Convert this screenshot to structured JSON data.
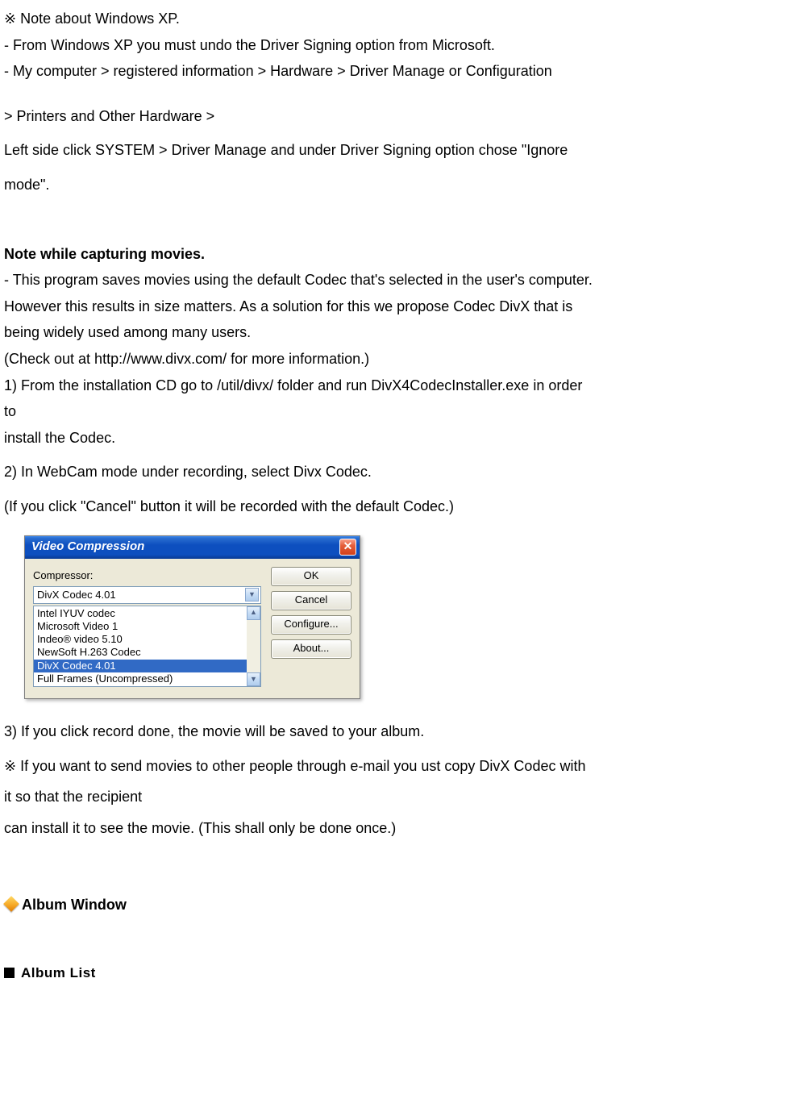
{
  "intro": {
    "note_symbol": "※",
    "note_text": "Note about Windows XP.",
    "bullet1_dash": "-",
    "bullet1_text": "From Windows XP you must undo the Driver Signing option from Microsoft.",
    "bullet2_dash": "-",
    "bullet2_text": "My computer > registered information > Hardware > Driver Manage or Configuration",
    "path_line": "> Printers and Other Hardware >",
    "instruction_line1": "Left side click SYSTEM > Driver Manage and under Driver Signing option chose \"Ignore",
    "instruction_line2": "mode\"."
  },
  "movies": {
    "heading": "Note while capturing movies.",
    "bullet_dash": "-",
    "bullet_text": "This program saves movies using the default Codec that's selected in the user's computer.",
    "para_line1": "However this results in size matters. As a solution for this we propose Codec DivX that is",
    "para_line2": "being widely used among many users.",
    "para_line3": "(Check out at http://www.divx.com/ for more information.)",
    "step1_line1": "1) From the installation CD go to /util/divx/ folder and run DivX4CodecInstaller.exe in order",
    "step1_line2": "to",
    "step1_line3": " install the Codec.",
    "step2": "2) In WebCam mode under recording, select Divx Codec.",
    "cancel_note": "(If you click \"Cancel\" button it will be recorded with the default Codec.)"
  },
  "dialog": {
    "title": "Video Compression",
    "close_x": "✕",
    "compressor_label": "Compressor:",
    "combo_value": "DivX Codec 4.01",
    "list": {
      "0": "Intel IYUV codec",
      "1": "Microsoft Video 1",
      "2": "Indeo® video 5.10",
      "3": "NewSoft H.263 Codec",
      "4": "DivX Codec 4.01",
      "5": "Full Frames (Uncompressed)"
    },
    "buttons": {
      "ok": "OK",
      "cancel": "Cancel",
      "configure": "Configure...",
      "about": "About..."
    }
  },
  "after_dialog": {
    "step3": "3) If you click record done, the movie will be saved to your album.",
    "note_symbol": "※",
    "note_line1": "If you want to send movies to other people through e-mail you ust copy DivX Codec with",
    "note_line2": "it so that the recipient",
    "note_line3": "can install it to see the movie. (This shall only be done once.)"
  },
  "album": {
    "window_heading": "Album Window",
    "list_heading": "Album List"
  }
}
